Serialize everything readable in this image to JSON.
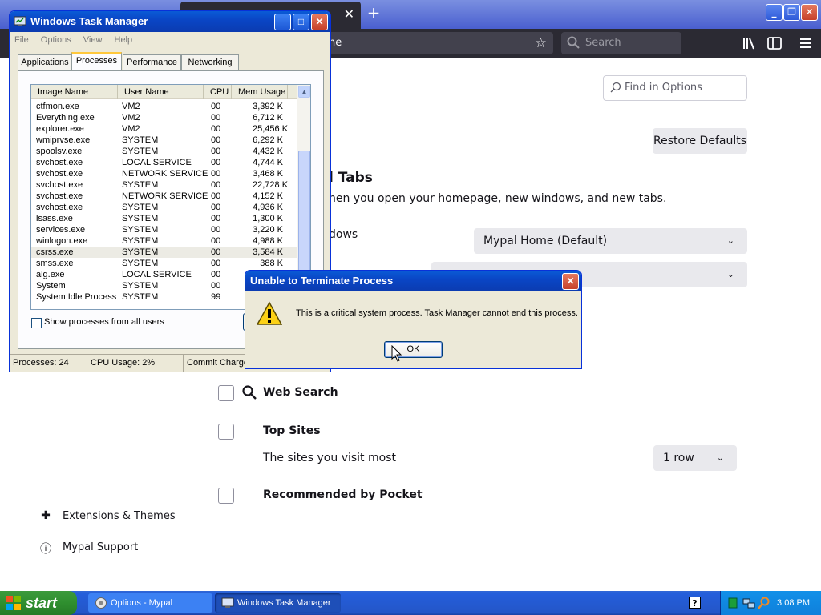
{
  "browser": {
    "tab_close_glyph": "✕",
    "new_tab_glyph": "+",
    "url_text": "ne",
    "search_placeholder": "Search",
    "minimize_glyph": "_",
    "restore_glyph": "❐",
    "close_glyph": "✕"
  },
  "options": {
    "find_placeholder": "Find in Options",
    "restore_defaults_label": "Restore Defaults",
    "section_heading": "l Tabs",
    "section_desc": "hen you open your homepage, new windows, and new tabs.",
    "homepage_label": "dows",
    "homepage_select_value": "Mypal Home (Default)",
    "second_select_value": "",
    "web_search_label": "Web Search",
    "top_sites_label": "Top Sites",
    "top_sites_desc": "The sites you visit most",
    "top_sites_rows_value": "1 row",
    "pocket_label": "Recommended by Pocket",
    "sidebar": [
      {
        "label": "Extensions & Themes"
      },
      {
        "label": "Mypal Support"
      }
    ]
  },
  "task_manager": {
    "title": "Windows Task Manager",
    "menu": [
      "File",
      "Options",
      "View",
      "Help"
    ],
    "tabs": [
      "Applications",
      "Processes",
      "Performance",
      "Networking"
    ],
    "columns": [
      "Image Name",
      "User Name",
      "CPU",
      "Mem Usage"
    ],
    "processes": [
      {
        "name": "ctfmon.exe",
        "user": "VM2",
        "cpu": "00",
        "mem": "3,392 K"
      },
      {
        "name": "Everything.exe",
        "user": "VM2",
        "cpu": "00",
        "mem": "6,712 K"
      },
      {
        "name": "explorer.exe",
        "user": "VM2",
        "cpu": "00",
        "mem": "25,456 K"
      },
      {
        "name": "wmiprvse.exe",
        "user": "SYSTEM",
        "cpu": "00",
        "mem": "6,292 K"
      },
      {
        "name": "spoolsv.exe",
        "user": "SYSTEM",
        "cpu": "00",
        "mem": "4,432 K"
      },
      {
        "name": "svchost.exe",
        "user": "LOCAL SERVICE",
        "cpu": "00",
        "mem": "4,744 K"
      },
      {
        "name": "svchost.exe",
        "user": "NETWORK SERVICE",
        "cpu": "00",
        "mem": "3,468 K"
      },
      {
        "name": "svchost.exe",
        "user": "SYSTEM",
        "cpu": "00",
        "mem": "22,728 K"
      },
      {
        "name": "svchost.exe",
        "user": "NETWORK SERVICE",
        "cpu": "00",
        "mem": "4,152 K"
      },
      {
        "name": "svchost.exe",
        "user": "SYSTEM",
        "cpu": "00",
        "mem": "4,936 K"
      },
      {
        "name": "lsass.exe",
        "user": "SYSTEM",
        "cpu": "00",
        "mem": "1,300 K"
      },
      {
        "name": "services.exe",
        "user": "SYSTEM",
        "cpu": "00",
        "mem": "3,220 K"
      },
      {
        "name": "winlogon.exe",
        "user": "SYSTEM",
        "cpu": "00",
        "mem": "4,988 K"
      },
      {
        "name": "csrss.exe",
        "user": "SYSTEM",
        "cpu": "00",
        "mem": "3,584 K"
      },
      {
        "name": "smss.exe",
        "user": "SYSTEM",
        "cpu": "00",
        "mem": "388 K"
      },
      {
        "name": "alg.exe",
        "user": "LOCAL SERVICE",
        "cpu": "00",
        "mem": ""
      },
      {
        "name": "System",
        "user": "SYSTEM",
        "cpu": "00",
        "mem": ""
      },
      {
        "name": "System Idle Process",
        "user": "SYSTEM",
        "cpu": "99",
        "mem": ""
      }
    ],
    "selected_row": 13,
    "show_all_label": "Show processes from all users",
    "status": {
      "processes": "Processes: 24",
      "cpu": "CPU Usage: 2%",
      "commit": "Commit Charge"
    }
  },
  "dialog": {
    "title": "Unable to Terminate Process",
    "message": "This is a critical system process.  Task Manager cannot end this process.",
    "ok_label": "OK"
  },
  "taskbar": {
    "start_label": "start",
    "items": [
      "Options - Mypal",
      "Windows Task Manager"
    ],
    "help_glyph": "?",
    "clock": "3:08 PM"
  },
  "colors": {
    "xp_blue": "#0a46c6",
    "start_green": "#2f8f2f",
    "browser_dark": "#2b2a33",
    "warning_yellow": "#fcd116"
  }
}
